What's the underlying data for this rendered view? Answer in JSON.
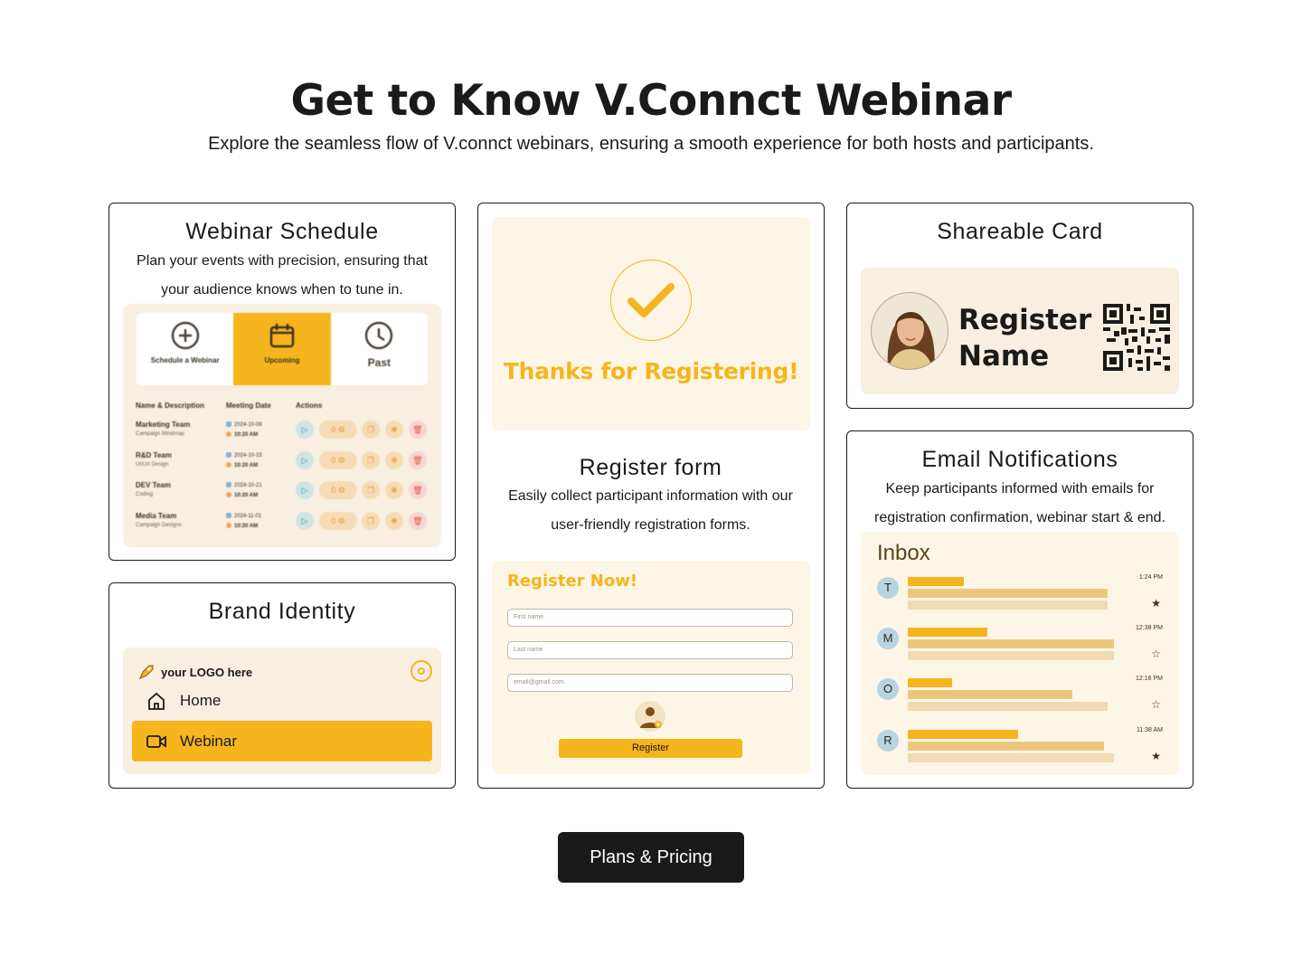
{
  "hero": {
    "title": "Get to Know V.Connct Webinar",
    "subtitle": "Explore the seamless flow of V.connct webinars, ensuring a smooth experience for both hosts and participants."
  },
  "schedule": {
    "title": "Webinar Schedule",
    "description": "Plan your events with precision, ensuring that your audience knows when to tune in.",
    "tabs": [
      {
        "label": "Schedule a Webinar",
        "icon": "plus-circle-icon"
      },
      {
        "label": "Upcoming",
        "icon": "calendar-icon",
        "active": true
      },
      {
        "label": "Past",
        "icon": "clock-icon"
      }
    ],
    "columns": [
      "Name & Description",
      "Meeting Date",
      "Actions"
    ],
    "rows": [
      {
        "name": "Marketing Team",
        "desc": "Campaign Mindmap",
        "date": "2024-10-08",
        "time": "10:20 AM",
        "count": "0"
      },
      {
        "name": "R&D Team",
        "desc": "UI/UX Design",
        "date": "2024-10-15",
        "time": "10:20 AM",
        "count": "0"
      },
      {
        "name": "DEV Team",
        "desc": "Coding",
        "date": "2024-10-21",
        "time": "10:20 AM",
        "count": "0"
      },
      {
        "name": "Media Team",
        "desc": "Campaign Designs",
        "date": "2024-11-01",
        "time": "10:20 AM",
        "count": "0"
      }
    ]
  },
  "brand": {
    "title": "Brand Identity",
    "logo_text": "your LOGO here",
    "nav_home": "Home",
    "nav_webinar": "Webinar"
  },
  "register": {
    "thanks": "Thanks for Registering!",
    "title": "Register form",
    "description": "Easily collect participant information with our user-friendly registration forms.",
    "form_title": "Register Now!",
    "first_name_placeholder": "First name",
    "last_name_placeholder": "Last name",
    "email_placeholder": "email@gmail.com",
    "button": "Register"
  },
  "share": {
    "title": "Shareable Card",
    "name_line1": "Register",
    "name_line2": "Name"
  },
  "email": {
    "title": "Email Notifications",
    "description": "Keep participants informed with emails for registration confirmation, webinar start & end.",
    "inbox": "Inbox",
    "messages": [
      {
        "initial": "T",
        "time": "1:24 PM",
        "starred": true
      },
      {
        "initial": "M",
        "time": "12:38 PM",
        "starred": false
      },
      {
        "initial": "O",
        "time": "12:16 PM",
        "starred": false
      },
      {
        "initial": "R",
        "time": "11:38 AM",
        "starred": true
      }
    ]
  },
  "cta": {
    "label": "Plans & Pricing"
  },
  "colors": {
    "accent": "#f6b51d",
    "panel": "#f8efe1",
    "dark": "#1a1a1a"
  }
}
